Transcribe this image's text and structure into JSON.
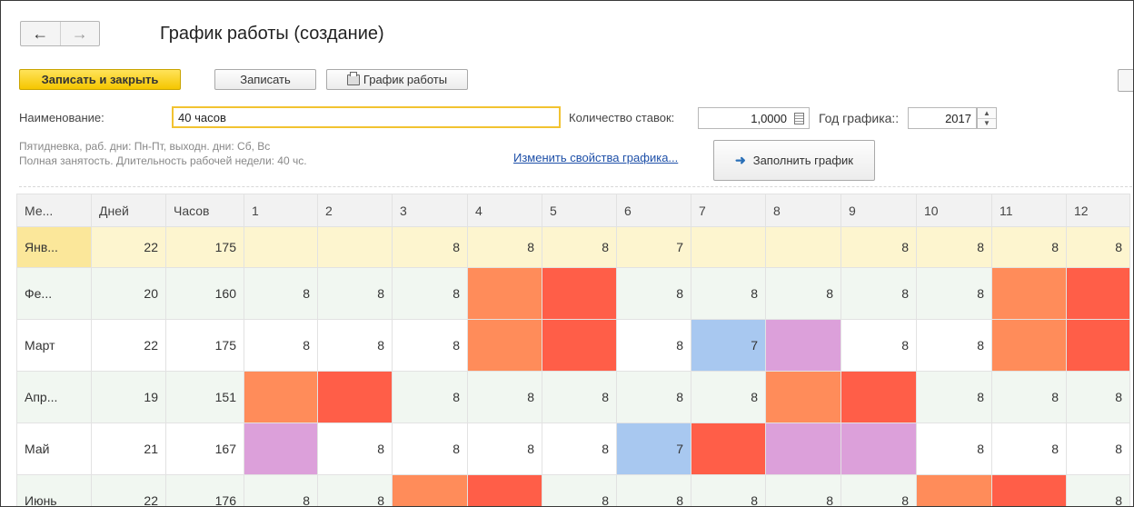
{
  "window": {
    "title": "График работы (создание)",
    "nav_back": "←",
    "nav_forward": "→"
  },
  "toolbar": {
    "save_close_label": "Записать и закрыть",
    "save_label": "Записать",
    "schedule_label": "График работы"
  },
  "form": {
    "name_label": "Наименование:",
    "name_value": "40 часов",
    "rates_label": "Количество ставок:",
    "rates_value": "1,0000",
    "year_label": "Год графика::",
    "year_value": "2017",
    "info_line1": "Пятидневка, раб. дни: Пн-Пт, выходн. дни: Сб, Вс",
    "info_line2": "Полная занятость. Длительность рабочей недели: 40 чс.",
    "change_props_link": "Изменить свойства графика...",
    "fill_button_label": "Заполнить график"
  },
  "colors": {
    "accent_yellow": "#f5c600",
    "weekend_orange": "#ff8c5a",
    "weekend_red": "#ff5e48",
    "preholiday_blue": "#a8c8f0",
    "holiday_purple": "#dca0da",
    "link_blue": "#1d4fa8"
  },
  "grid": {
    "headers": [
      "Ме...",
      "Дней",
      "Часов",
      "1",
      "2",
      "3",
      "4",
      "5",
      "6",
      "7",
      "8",
      "9",
      "10",
      "11",
      "12"
    ],
    "rows": [
      {
        "month": "Янв...",
        "days": "22",
        "hours": "175",
        "cells": [
          "",
          "",
          "8",
          "8",
          "8",
          "7",
          "",
          "",
          "8",
          "8",
          "8",
          "8"
        ],
        "types": [
          "",
          "",
          "",
          "",
          "",
          "",
          "",
          "",
          "",
          "",
          "",
          ""
        ]
      },
      {
        "month": "Фе...",
        "days": "20",
        "hours": "160",
        "cells": [
          "8",
          "8",
          "8",
          "",
          "",
          "8",
          "8",
          "8",
          "8",
          "8",
          "",
          ""
        ],
        "types": [
          "",
          "",
          "",
          "o",
          "r",
          "",
          "",
          "",
          "",
          "",
          "o",
          "r"
        ]
      },
      {
        "month": "Март",
        "days": "22",
        "hours": "175",
        "cells": [
          "8",
          "8",
          "8",
          "",
          "",
          "8",
          "7",
          "",
          "8",
          "8",
          "",
          ""
        ],
        "types": [
          "",
          "",
          "",
          "o",
          "r",
          "",
          "b",
          "p",
          "",
          "",
          "o",
          "r"
        ]
      },
      {
        "month": "Апр...",
        "days": "19",
        "hours": "151",
        "cells": [
          "",
          "",
          "8",
          "8",
          "8",
          "8",
          "8",
          "",
          "",
          "8",
          "8",
          "8"
        ],
        "types": [
          "o",
          "r",
          "",
          "",
          "",
          "",
          "",
          "o",
          "r",
          "",
          "",
          ""
        ]
      },
      {
        "month": "Май",
        "days": "21",
        "hours": "167",
        "cells": [
          "",
          "8",
          "8",
          "8",
          "8",
          "7",
          "",
          "",
          "",
          "8",
          "8",
          "8"
        ],
        "types": [
          "p",
          "",
          "",
          "",
          "",
          "b",
          "r",
          "p",
          "p",
          "",
          "",
          ""
        ]
      },
      {
        "month": "Июнь",
        "days": "22",
        "hours": "176",
        "cells": [
          "8",
          "8",
          "",
          "",
          "8",
          "8",
          "8",
          "8",
          "8",
          "",
          "",
          "8"
        ],
        "types": [
          "",
          "",
          "o",
          "r",
          "",
          "",
          "",
          "",
          "",
          "o",
          "r",
          ""
        ]
      }
    ]
  }
}
